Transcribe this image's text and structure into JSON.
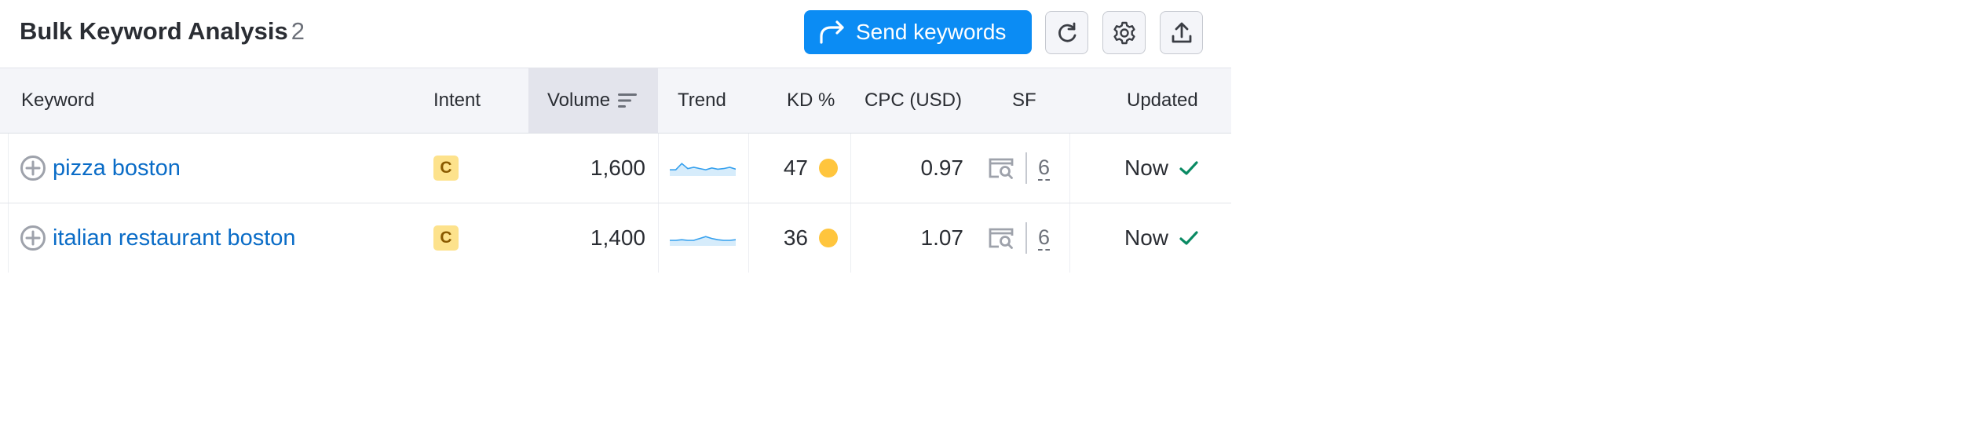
{
  "header": {
    "title": "Bulk Keyword Analysis",
    "count": "2",
    "send_label": "Send keywords",
    "accent_color": "#0b8cf4"
  },
  "columns": {
    "keyword": "Keyword",
    "intent": "Intent",
    "volume": "Volume",
    "trend": "Trend",
    "kd": "KD %",
    "cpc": "CPC (USD)",
    "sf": "SF",
    "updated": "Updated"
  },
  "rows": [
    {
      "keyword": "pizza boston",
      "intent": "C",
      "volume": "1,600",
      "trend": [
        0.3,
        0.3,
        0.8,
        0.4,
        0.5,
        0.4,
        0.3,
        0.45,
        0.35,
        0.4,
        0.5,
        0.35
      ],
      "kd": "47",
      "cpc": "0.97",
      "sf": "6",
      "updated": "Now"
    },
    {
      "keyword": "italian restaurant boston",
      "intent": "C",
      "volume": "1,400",
      "trend": [
        0.25,
        0.25,
        0.3,
        0.25,
        0.25,
        0.4,
        0.55,
        0.4,
        0.3,
        0.25,
        0.25,
        0.3
      ],
      "kd": "36",
      "cpc": "1.07",
      "sf": "6",
      "updated": "Now"
    }
  ],
  "colors": {
    "kd_dot": "#ffc53d",
    "intent_badge": "#fde28c",
    "link": "#0a6cc7",
    "check": "#0a8a63"
  },
  "icons": {
    "send": "share-arrow-icon",
    "refresh": "refresh-icon",
    "settings": "gear-icon",
    "export": "upload-icon",
    "add": "plus-circle-icon",
    "sort": "sort-descending-icon",
    "serp": "serp-features-icon",
    "updated": "checkmark-icon"
  }
}
